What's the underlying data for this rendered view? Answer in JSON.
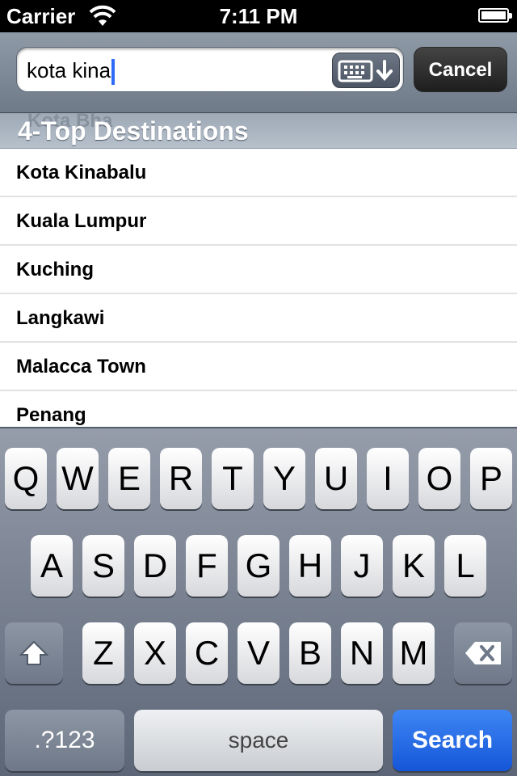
{
  "status_bar": {
    "carrier": "Carrier",
    "time": "7:11 PM"
  },
  "search": {
    "value": "kota kina",
    "cancel_label": "Cancel"
  },
  "section": {
    "ghost_text": "Kota Bha",
    "title": "4-Top Destinations"
  },
  "results": [
    "Kota Kinabalu",
    "Kuala Lumpur",
    "Kuching",
    "Langkawi",
    "Malacca Town",
    "Penang"
  ],
  "keyboard": {
    "row1": [
      "Q",
      "W",
      "E",
      "R",
      "T",
      "Y",
      "U",
      "I",
      "O",
      "P"
    ],
    "row2": [
      "A",
      "S",
      "D",
      "F",
      "G",
      "H",
      "J",
      "K",
      "L"
    ],
    "row3": [
      "Z",
      "X",
      "C",
      "V",
      "B",
      "N",
      "M"
    ],
    "numbers_label": ".?123",
    "space_label": "space",
    "search_label": "Search"
  },
  "colors": {
    "accent_blue": "#1556d8",
    "caret": "#2f6bf6"
  }
}
